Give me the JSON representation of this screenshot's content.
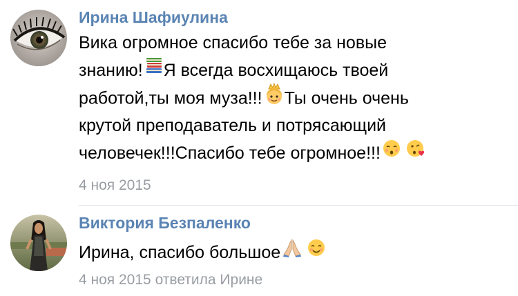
{
  "comments": [
    {
      "author": "Ирина Шафиулина",
      "avatar_icon": "eye-avatar",
      "lines": [
        {
          "parts": [
            "Вика огромное спасибо тебе за новые"
          ]
        },
        {
          "parts": [
            "знанию!",
            "Я всегда восхищаюсь твоей"
          ]
        },
        {
          "parts": [
            "работой,ты моя муза!!!",
            "Ты очень очень"
          ]
        },
        {
          "parts": [
            "крутой преподаватель и потрясающий"
          ]
        },
        {
          "parts": [
            "человечек!!!Спасибо тебе огромное!!!"
          ]
        }
      ],
      "emojis": [
        "books-emoji",
        "princess-emoji",
        "kissing-emoji",
        "kiss-heart-emoji"
      ],
      "date": "4 ноя 2015"
    },
    {
      "author": "Виктория Безпаленко",
      "avatar_icon": "woman-photo-avatar",
      "text": "Ирина, спасибо большое",
      "emojis": [
        "praying-hands-emoji",
        "smiling-emoji"
      ],
      "date": "4 ноя 2015",
      "reply_to": "ответила Ирине"
    }
  ],
  "colors": {
    "author": "#5a84b3",
    "meta": "#999da3",
    "text": "#000000",
    "divider": "#dfe3e8"
  }
}
